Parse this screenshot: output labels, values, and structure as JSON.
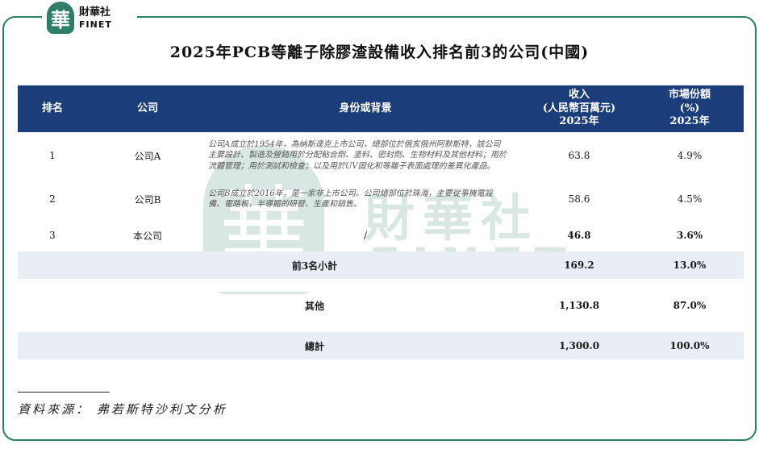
{
  "brand": {
    "seal_char": "華",
    "name_cn": "財華社",
    "name_en": "FINET"
  },
  "title": "2025年PCB等離子除膠渣設備收入排名前3的公司(中國)",
  "table": {
    "headers": {
      "rank": "排名",
      "company": "公司",
      "background": "身份或背景",
      "revenue_l1": "收入",
      "revenue_l2": "(人民幣百萬元)",
      "revenue_l3": "2025年",
      "share_l1": "市場份額",
      "share_l2": "(%)",
      "share_l3": "2025年"
    },
    "rows": [
      {
        "rank": "1",
        "company": "公司A",
        "background": "公司A成立於1954年，為納斯達克上市公司，總部位於俄亥俄州阿默斯特，該公司主要設計、製造及營銷用於分配粘合劑、塗料、密封劑、生物材料及其他材料；用於流體管理；用於測試和檢查；以及用於UV固化和等離子表面處理的差異化產品。",
        "revenue": "63.8",
        "share": "4.9%"
      },
      {
        "rank": "2",
        "company": "公司B",
        "background": "公司B成立於2016年，是一家非上市公司。公司總部位於珠海，主要從事機電設備、電路板，半導體的研發、生產和銷售。",
        "revenue": "58.6",
        "share": "4.5%"
      },
      {
        "rank": "3",
        "company": "本公司",
        "background": "/",
        "revenue": "46.8",
        "share": "3.6%"
      }
    ],
    "summary": [
      {
        "label": "前3名小計",
        "revenue": "169.2",
        "share": "13.0%"
      },
      {
        "label": "其他",
        "revenue": "1,130.8",
        "share": "87.0%"
      },
      {
        "label": "總計",
        "revenue": "1,300.0",
        "share": "100.0%"
      }
    ]
  },
  "source": "資料來源： 弗若斯特沙利文分析",
  "colors": {
    "header_bg": "#1b3d7a",
    "frame": "#2f7d6b",
    "shade": "#e9edf4"
  }
}
